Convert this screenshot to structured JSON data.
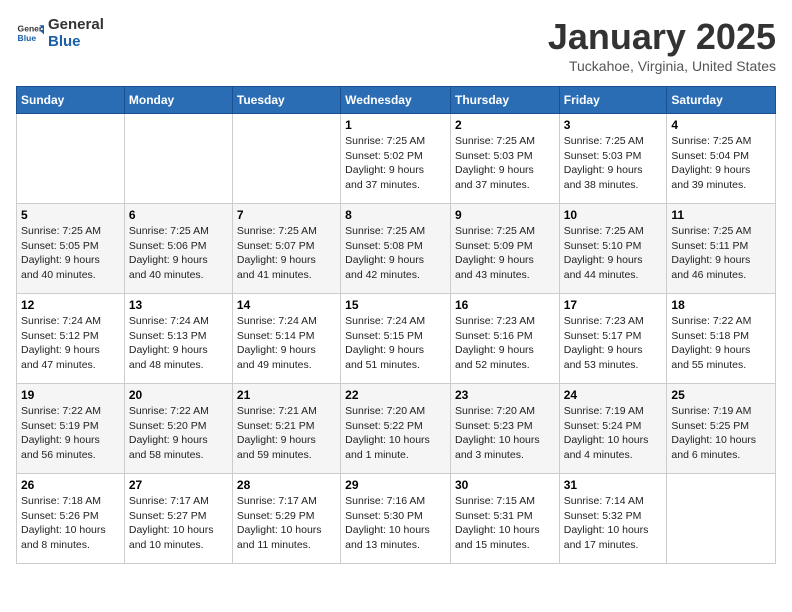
{
  "logo": {
    "general": "General",
    "blue": "Blue"
  },
  "header": {
    "month": "January 2025",
    "location": "Tuckahoe, Virginia, United States"
  },
  "weekdays": [
    "Sunday",
    "Monday",
    "Tuesday",
    "Wednesday",
    "Thursday",
    "Friday",
    "Saturday"
  ],
  "weeks": [
    [
      {
        "day": "",
        "info": ""
      },
      {
        "day": "",
        "info": ""
      },
      {
        "day": "",
        "info": ""
      },
      {
        "day": "1",
        "info": "Sunrise: 7:25 AM\nSunset: 5:02 PM\nDaylight: 9 hours\nand 37 minutes."
      },
      {
        "day": "2",
        "info": "Sunrise: 7:25 AM\nSunset: 5:03 PM\nDaylight: 9 hours\nand 37 minutes."
      },
      {
        "day": "3",
        "info": "Sunrise: 7:25 AM\nSunset: 5:03 PM\nDaylight: 9 hours\nand 38 minutes."
      },
      {
        "day": "4",
        "info": "Sunrise: 7:25 AM\nSunset: 5:04 PM\nDaylight: 9 hours\nand 39 minutes."
      }
    ],
    [
      {
        "day": "5",
        "info": "Sunrise: 7:25 AM\nSunset: 5:05 PM\nDaylight: 9 hours\nand 40 minutes."
      },
      {
        "day": "6",
        "info": "Sunrise: 7:25 AM\nSunset: 5:06 PM\nDaylight: 9 hours\nand 40 minutes."
      },
      {
        "day": "7",
        "info": "Sunrise: 7:25 AM\nSunset: 5:07 PM\nDaylight: 9 hours\nand 41 minutes."
      },
      {
        "day": "8",
        "info": "Sunrise: 7:25 AM\nSunset: 5:08 PM\nDaylight: 9 hours\nand 42 minutes."
      },
      {
        "day": "9",
        "info": "Sunrise: 7:25 AM\nSunset: 5:09 PM\nDaylight: 9 hours\nand 43 minutes."
      },
      {
        "day": "10",
        "info": "Sunrise: 7:25 AM\nSunset: 5:10 PM\nDaylight: 9 hours\nand 44 minutes."
      },
      {
        "day": "11",
        "info": "Sunrise: 7:25 AM\nSunset: 5:11 PM\nDaylight: 9 hours\nand 46 minutes."
      }
    ],
    [
      {
        "day": "12",
        "info": "Sunrise: 7:24 AM\nSunset: 5:12 PM\nDaylight: 9 hours\nand 47 minutes."
      },
      {
        "day": "13",
        "info": "Sunrise: 7:24 AM\nSunset: 5:13 PM\nDaylight: 9 hours\nand 48 minutes."
      },
      {
        "day": "14",
        "info": "Sunrise: 7:24 AM\nSunset: 5:14 PM\nDaylight: 9 hours\nand 49 minutes."
      },
      {
        "day": "15",
        "info": "Sunrise: 7:24 AM\nSunset: 5:15 PM\nDaylight: 9 hours\nand 51 minutes."
      },
      {
        "day": "16",
        "info": "Sunrise: 7:23 AM\nSunset: 5:16 PM\nDaylight: 9 hours\nand 52 minutes."
      },
      {
        "day": "17",
        "info": "Sunrise: 7:23 AM\nSunset: 5:17 PM\nDaylight: 9 hours\nand 53 minutes."
      },
      {
        "day": "18",
        "info": "Sunrise: 7:22 AM\nSunset: 5:18 PM\nDaylight: 9 hours\nand 55 minutes."
      }
    ],
    [
      {
        "day": "19",
        "info": "Sunrise: 7:22 AM\nSunset: 5:19 PM\nDaylight: 9 hours\nand 56 minutes."
      },
      {
        "day": "20",
        "info": "Sunrise: 7:22 AM\nSunset: 5:20 PM\nDaylight: 9 hours\nand 58 minutes."
      },
      {
        "day": "21",
        "info": "Sunrise: 7:21 AM\nSunset: 5:21 PM\nDaylight: 9 hours\nand 59 minutes."
      },
      {
        "day": "22",
        "info": "Sunrise: 7:20 AM\nSunset: 5:22 PM\nDaylight: 10 hours\nand 1 minute."
      },
      {
        "day": "23",
        "info": "Sunrise: 7:20 AM\nSunset: 5:23 PM\nDaylight: 10 hours\nand 3 minutes."
      },
      {
        "day": "24",
        "info": "Sunrise: 7:19 AM\nSunset: 5:24 PM\nDaylight: 10 hours\nand 4 minutes."
      },
      {
        "day": "25",
        "info": "Sunrise: 7:19 AM\nSunset: 5:25 PM\nDaylight: 10 hours\nand 6 minutes."
      }
    ],
    [
      {
        "day": "26",
        "info": "Sunrise: 7:18 AM\nSunset: 5:26 PM\nDaylight: 10 hours\nand 8 minutes."
      },
      {
        "day": "27",
        "info": "Sunrise: 7:17 AM\nSunset: 5:27 PM\nDaylight: 10 hours\nand 10 minutes."
      },
      {
        "day": "28",
        "info": "Sunrise: 7:17 AM\nSunset: 5:29 PM\nDaylight: 10 hours\nand 11 minutes."
      },
      {
        "day": "29",
        "info": "Sunrise: 7:16 AM\nSunset: 5:30 PM\nDaylight: 10 hours\nand 13 minutes."
      },
      {
        "day": "30",
        "info": "Sunrise: 7:15 AM\nSunset: 5:31 PM\nDaylight: 10 hours\nand 15 minutes."
      },
      {
        "day": "31",
        "info": "Sunrise: 7:14 AM\nSunset: 5:32 PM\nDaylight: 10 hours\nand 17 minutes."
      },
      {
        "day": "",
        "info": ""
      }
    ]
  ]
}
